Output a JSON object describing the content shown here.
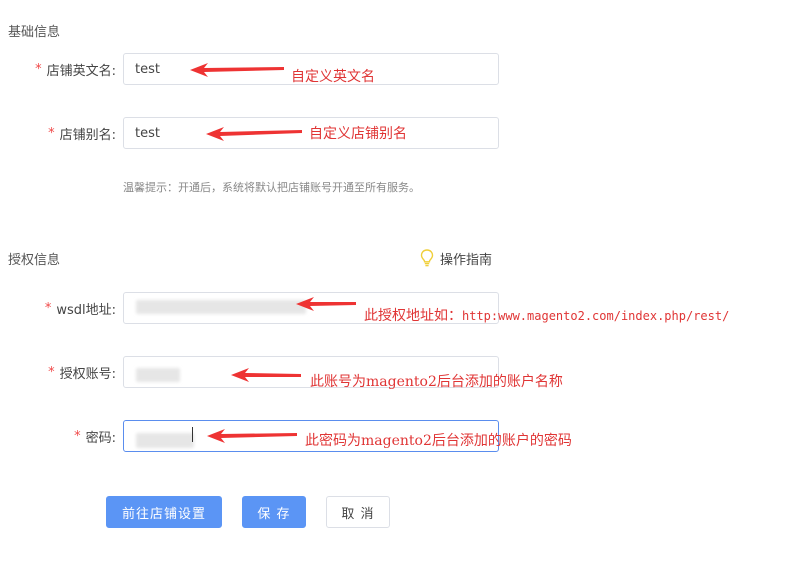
{
  "basic_section": {
    "title": "基础信息",
    "store_en_name": {
      "label": "店铺英文名:",
      "value": "test",
      "annotation": "自定义英文名"
    },
    "store_alias": {
      "label": "店铺别名:",
      "value": "test",
      "annotation": "自定义店铺别名"
    },
    "hint": "温馨提示：开通后，系统将默认把店铺账号开通至所有服务。"
  },
  "auth_section": {
    "title": "授权信息",
    "guide_label": "操作指南",
    "wsdl": {
      "label": "wsdl地址:",
      "annotation_prefix": "此授权地址如：",
      "annotation_url": "http:www.magento2.com/index.php/rest/"
    },
    "account": {
      "label": "授权账号:",
      "annotation": "此账号为magento2后台添加的账户名称"
    },
    "password": {
      "label": "密码:",
      "annotation": "此密码为magento2后台添加的账户的密码"
    }
  },
  "buttons": {
    "goto_settings": "前往店铺设置",
    "save": "保 存",
    "cancel": "取 消"
  },
  "colors": {
    "primary": "#5b95f5",
    "required_star": "#f04848",
    "annotation": "#e03535",
    "bulb": "#f5d84a"
  },
  "icons": {
    "guide": "lightbulb-icon",
    "annotation_pointer": "red-arrow-icon"
  }
}
